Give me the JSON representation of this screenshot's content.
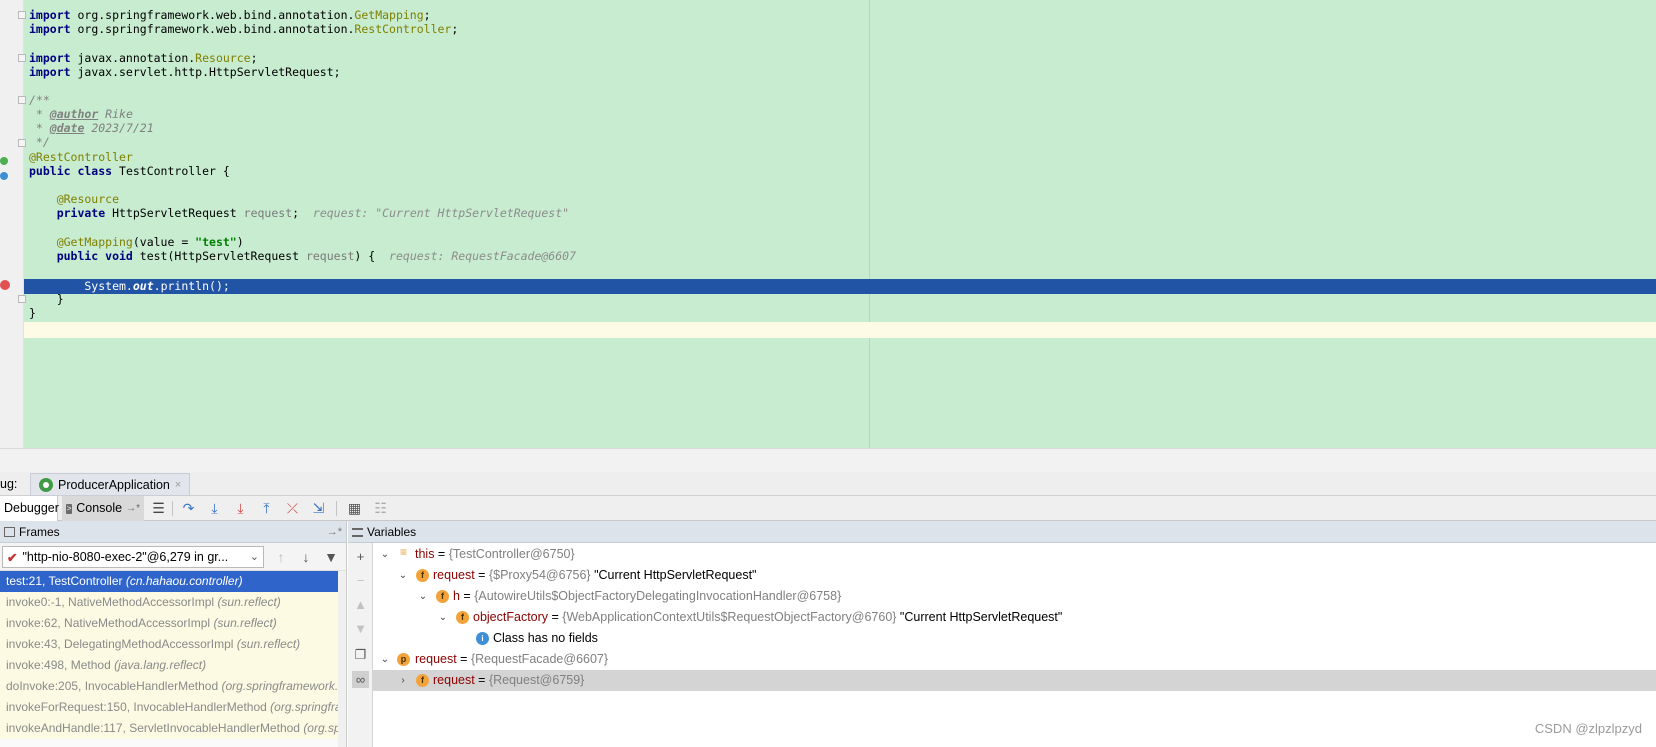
{
  "editor": {
    "lines": {
      "l1_import": "import",
      "l1_pkg": " org.springframework.web.bind.annotation.",
      "l1_cls": "GetMapping",
      "l1_end": ";",
      "l2_import": "import",
      "l2_pkg": " org.springframework.web.bind.annotation.",
      "l2_cls": "RestController",
      "l2_end": ";",
      "l3_import": "import",
      "l3_pkg": " javax.annotation.",
      "l3_cls": "Resource",
      "l3_end": ";",
      "l4_import": "import",
      "l4_rest": " javax.servlet.http.HttpServletRequest;",
      "doc_open": "/**",
      "doc_author_pre": " * ",
      "doc_author_tag": "@author",
      "doc_author_val": " Rike",
      "doc_date_pre": " * ",
      "doc_date_tag": "@date",
      "doc_date_val": " 2023/7/21",
      "doc_close": " */",
      "ann_rest": "@RestController",
      "class_kw": "public class",
      "class_rest": " TestController {",
      "ann_resource": "    @Resource",
      "field_kw": "    private",
      "field_type": " HttpServletRequest ",
      "field_name": "request",
      "field_end": ";",
      "field_hint": "  request: \"Current HttpServletRequest\"",
      "ann_get": "    @GetMapping",
      "ann_get_args_a": "(value = ",
      "ann_get_str": "\"test\"",
      "ann_get_args_b": ")",
      "method_kw": "    public void",
      "method_sig": " test(HttpServletRequest ",
      "method_param": "request",
      "method_end": ") {",
      "method_hint": "  request: RequestFacade@6607",
      "exec_pre": "        System.",
      "exec_out": "out",
      "exec_post": ".println();",
      "close_method": "    }",
      "close_class": "}"
    }
  },
  "debug": {
    "label": "ug:",
    "run_config": "ProducerApplication",
    "close": "×"
  },
  "toolbar": {
    "debugger_tab": "Debugger",
    "console_tab": "Console",
    "console_suffix": "→*"
  },
  "frames": {
    "title": "Frames",
    "pin": "→*",
    "thread": "\"http-nio-8080-exec-2\"@6,279 in gr...",
    "items": [
      {
        "method": "test:21, TestController ",
        "pkg": "(cn.hahaou.controller)"
      },
      {
        "method": "invoke0:-1, NativeMethodAccessorImpl ",
        "pkg": "(sun.reflect)"
      },
      {
        "method": "invoke:62, NativeMethodAccessorImpl ",
        "pkg": "(sun.reflect)"
      },
      {
        "method": "invoke:43, DelegatingMethodAccessorImpl ",
        "pkg": "(sun.reflect)"
      },
      {
        "method": "invoke:498, Method ",
        "pkg": "(java.lang.reflect)"
      },
      {
        "method": "doInvoke:205, InvocableHandlerMethod ",
        "pkg": "(org.springframework.web.method.support)"
      },
      {
        "method": "invokeForRequest:150, InvocableHandlerMethod ",
        "pkg": "(org.springframework.web.method.support)"
      },
      {
        "method": "invokeAndHandle:117, ServletInvocableHandlerMethod ",
        "pkg": "(org.springframework.web.servlet.mvc)"
      }
    ]
  },
  "variables": {
    "title": "Variables",
    "rows": [
      {
        "name": "this",
        "eq": " = ",
        "type": "{TestController@6750}",
        "value": ""
      },
      {
        "name": "request",
        "eq": " = ",
        "type": "{$Proxy54@6756}",
        "value": " \"Current HttpServletRequest\""
      },
      {
        "name": "h",
        "eq": " = ",
        "type": "{AutowireUtils$ObjectFactoryDelegatingInvocationHandler@6758}",
        "value": ""
      },
      {
        "name": "objectFactory",
        "eq": " = ",
        "type": "{WebApplicationContextUtils$RequestObjectFactory@6760}",
        "value": " \"Current HttpServletRequest\""
      },
      {
        "name": "",
        "eq": "",
        "type": "",
        "value": "Class has no fields"
      },
      {
        "name": "request",
        "eq": " = ",
        "type": "{RequestFacade@6607}",
        "value": ""
      },
      {
        "name": "request",
        "eq": " = ",
        "type": "{Request@6759}",
        "value": ""
      }
    ],
    "icons": {
      "field": "f",
      "param": "p",
      "info": "i",
      "this": "≡"
    }
  },
  "watermark": "CSDN @zlpzlpzyd",
  "colors": {
    "editor_bg": "#c7ecd0",
    "exec_line": "#2154a5",
    "frame_selected": "#2f65ca"
  }
}
